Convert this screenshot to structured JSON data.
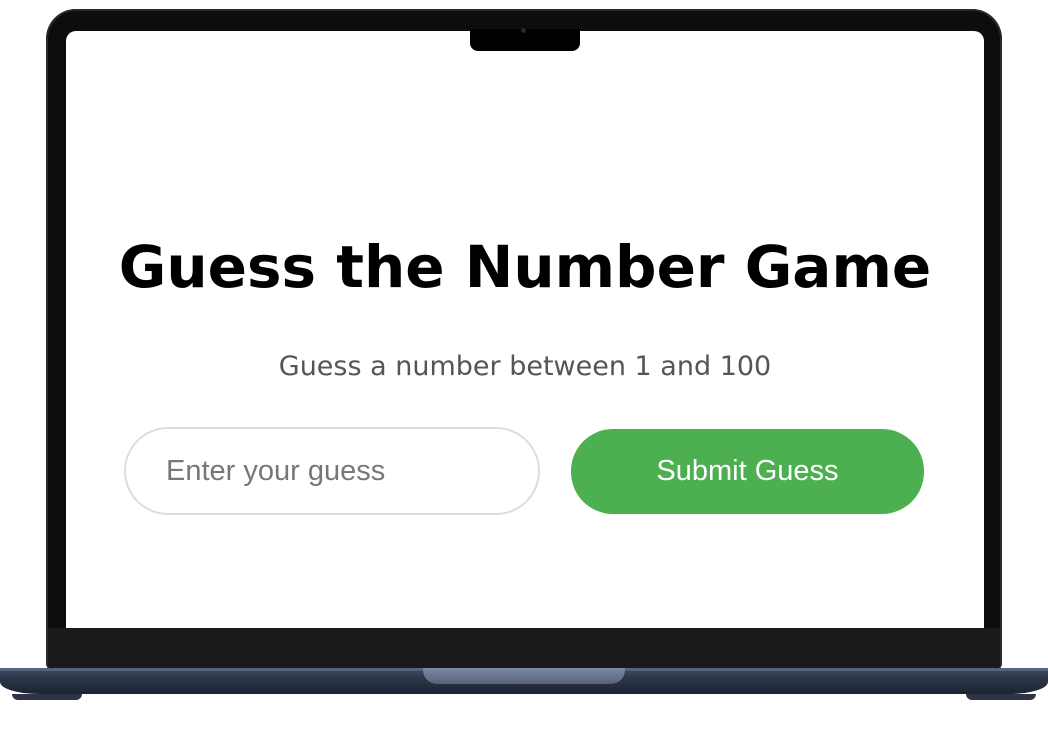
{
  "game": {
    "title": "Guess the Number Game",
    "instructions": "Guess a number between 1 and 100",
    "guess_input": {
      "value": "",
      "placeholder": "Enter your guess"
    },
    "submit_label": "Submit Guess"
  },
  "colors": {
    "accent": "#4caf50",
    "title": "#000000",
    "subtitle": "#555555",
    "input_border": "#dddddd",
    "laptop_bezel": "#0d0d0d",
    "laptop_base": "#2b3446"
  }
}
